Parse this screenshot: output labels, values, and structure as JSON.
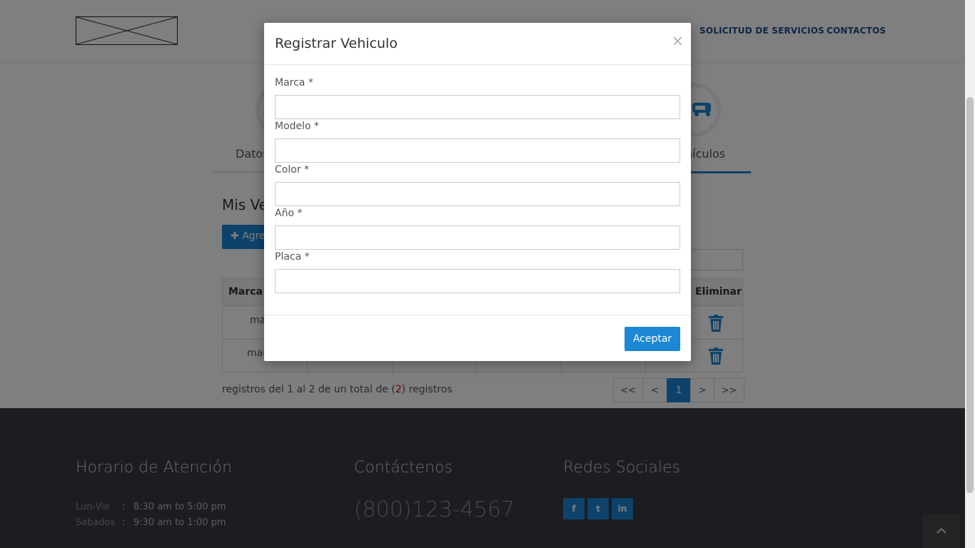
{
  "header": {
    "nav": {
      "services": "SOLICITUD DE SERVICIOS",
      "contacts": "CONTACTOS"
    }
  },
  "steps": {
    "first_partial": "Datos",
    "last_partial": "hículos"
  },
  "section": {
    "title_partial": "Mis Ve",
    "add_button_partial": "Agre"
  },
  "table": {
    "headers": {
      "marca": "Marca",
      "eliminar": "Eliminar"
    },
    "rows": [
      {
        "marca_partial": "ma"
      },
      {
        "marca_partial": "mar"
      }
    ]
  },
  "records": {
    "prefix": "registros del 1 al 2 de un total de (",
    "count": "2",
    "suffix": ") registros"
  },
  "pager": {
    "first": "<<",
    "prev": "<",
    "current": "1",
    "next": ">",
    "last": ">>"
  },
  "footer": {
    "hours_title": "Horario de Atención",
    "hours": [
      {
        "days": "Lun-Vie",
        "sep": ":",
        "time": "8:30 am to 5:00 pm"
      },
      {
        "days": "Sabados",
        "sep": ":",
        "time": "9:30 am to 1:00 pm"
      }
    ],
    "contact_title": "Contáctenos",
    "phone": "(800)123-4567",
    "social_title": "Redes Sociales",
    "social": {
      "facebook": "f",
      "twitter": "t",
      "linkedin": "in"
    }
  },
  "modal": {
    "title": "Registrar Vehiculo",
    "close": "×",
    "fields": {
      "marca": {
        "label": "Marca *",
        "value": "",
        "placeholder": ""
      },
      "modelo": {
        "label": "Modelo *",
        "value": "",
        "placeholder": ""
      },
      "color": {
        "label": "Color *",
        "value": "",
        "placeholder": ""
      },
      "anio": {
        "label": "Año *",
        "value": "",
        "placeholder": ""
      },
      "placa": {
        "label": "Placa *",
        "value": "",
        "placeholder": ""
      }
    },
    "accept": "Aceptar"
  },
  "colors": {
    "accent": "#1b87d5",
    "nav": "#1f4e8c",
    "footer_bg": "#383b40",
    "count": "#cc0000"
  },
  "icons": {
    "plus": "plus-icon",
    "trash": "trash-icon",
    "car": "car-icon",
    "up": "chevron-up-icon"
  }
}
